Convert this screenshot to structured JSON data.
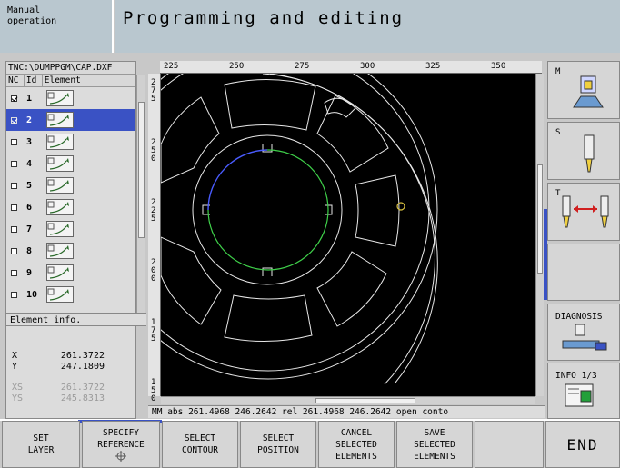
{
  "header": {
    "mode_line1": "Manual",
    "mode_line2": "operation",
    "title": "Programming and editing"
  },
  "left_panel": {
    "path": "TNC:\\DUMPPGM\\CAP.DXF",
    "columns": {
      "nc": "NC",
      "id": "Id",
      "element": "Element"
    },
    "rows": [
      {
        "id": "1",
        "checked": true,
        "selected": false
      },
      {
        "id": "2",
        "checked": true,
        "selected": true
      },
      {
        "id": "3",
        "checked": false,
        "selected": false
      },
      {
        "id": "4",
        "checked": false,
        "selected": false
      },
      {
        "id": "5",
        "checked": false,
        "selected": false
      },
      {
        "id": "6",
        "checked": false,
        "selected": false
      },
      {
        "id": "7",
        "checked": false,
        "selected": false
      },
      {
        "id": "8",
        "checked": false,
        "selected": false
      },
      {
        "id": "9",
        "checked": false,
        "selected": false
      },
      {
        "id": "10",
        "checked": false,
        "selected": false
      }
    ],
    "info": {
      "title": "Element info.",
      "x_label": "X",
      "x_value": "261.3722",
      "y_label": "Y",
      "y_value": "247.1809",
      "xs_label": "XS",
      "xs_value": "261.3722",
      "ys_label": "YS",
      "ys_value": "245.8313"
    }
  },
  "rulers": {
    "top_ticks": [
      "225",
      "250",
      "275",
      "300",
      "325",
      "350"
    ],
    "left_ticks": [
      "275",
      "250",
      "225",
      "200",
      "175",
      "150"
    ]
  },
  "status": {
    "unit": "MM",
    "text": "abs 261.4968 246.2642 rel 261.4968 246.2642 open conto"
  },
  "right_softkeys": {
    "m_label": "M",
    "s_label": "S",
    "t_label": "T",
    "diagnosis": "DIAGNOSIS",
    "info": "INFO 1/3"
  },
  "bottom_softkeys": {
    "set_layer": [
      "SET",
      "LAYER"
    ],
    "specify_reference": [
      "SPECIFY",
      "REFERENCE"
    ],
    "select_contour": [
      "SELECT",
      "CONTOUR"
    ],
    "select_position": [
      "SELECT",
      "POSITION"
    ],
    "cancel_selected": [
      "CANCEL",
      "SELECTED",
      "ELEMENTS"
    ],
    "save_selected": [
      "SAVE",
      "SELECTED",
      "ELEMENTS"
    ],
    "end": "END"
  },
  "colors": {
    "header_bg": "#b9c7cf",
    "selection": "#3a52c4",
    "drawing_line": "#ffffff",
    "contour_green": "#3fd04a",
    "contour_blue": "#4a5cff",
    "point_yellow": "#d8c040"
  }
}
